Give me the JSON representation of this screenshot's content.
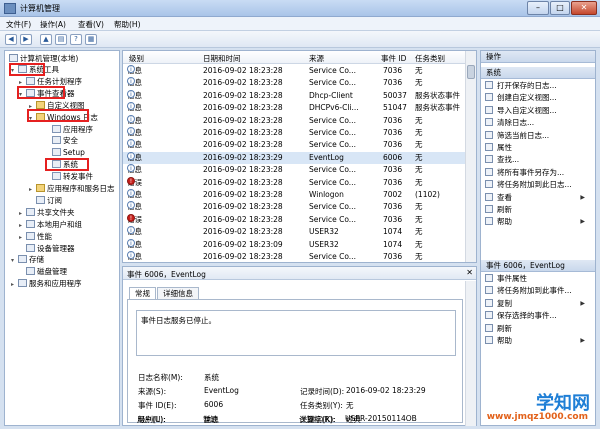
{
  "window": {
    "title": "计算机管理",
    "buttons": [
      "–",
      "□",
      "✕"
    ]
  },
  "menu": [
    "文件(F)",
    "操作(A)",
    "查看(V)",
    "帮助(H)"
  ],
  "tree": {
    "root": "计算机管理(本地)",
    "items": [
      {
        "label": "系统工具",
        "level": 0,
        "arrow": "▾",
        "icon": "computer-tools-icon"
      },
      {
        "label": "任务计划程序",
        "level": 1,
        "arrow": "▸",
        "icon": "clock-icon"
      },
      {
        "label": "事件查看器",
        "level": 1,
        "arrow": "▾",
        "icon": "event-viewer-icon"
      },
      {
        "label": "自定义视图",
        "level": 2,
        "arrow": "▸",
        "icon": "folder-icon"
      },
      {
        "label": "Windows 日志",
        "level": 2,
        "arrow": "▾",
        "icon": "folder-icon"
      },
      {
        "label": "应用程序",
        "level": 3,
        "arrow": "",
        "icon": "log-icon"
      },
      {
        "label": "安全",
        "level": 3,
        "arrow": "",
        "icon": "log-icon"
      },
      {
        "label": "Setup",
        "level": 3,
        "arrow": "",
        "icon": "log-icon"
      },
      {
        "label": "系统",
        "level": 3,
        "arrow": "",
        "icon": "log-icon"
      },
      {
        "label": "转发事件",
        "level": 3,
        "arrow": "",
        "icon": "log-icon"
      },
      {
        "label": "应用程序和服务日志",
        "level": 2,
        "arrow": "▸",
        "icon": "folder-icon"
      },
      {
        "label": "订阅",
        "level": 2,
        "arrow": "",
        "icon": "subscription-icon"
      },
      {
        "label": "共享文件夹",
        "level": 1,
        "arrow": "▸",
        "icon": "shared-folder-icon"
      },
      {
        "label": "本地用户和组",
        "level": 1,
        "arrow": "▸",
        "icon": "users-icon"
      },
      {
        "label": "性能",
        "level": 1,
        "arrow": "▸",
        "icon": "performance-icon"
      },
      {
        "label": "设备管理器",
        "level": 1,
        "arrow": "",
        "icon": "device-manager-icon"
      },
      {
        "label": "存储",
        "level": 0,
        "arrow": "▾",
        "icon": "storage-icon"
      },
      {
        "label": "磁盘管理",
        "level": 1,
        "arrow": "",
        "icon": "disk-icon"
      },
      {
        "label": "服务和应用程序",
        "level": 0,
        "arrow": "▸",
        "icon": "services-icon"
      }
    ]
  },
  "events": {
    "columns": [
      "级别",
      "日期和时间",
      "来源",
      "事件 ID",
      "任务类别"
    ],
    "rows": [
      {
        "level": "信息",
        "type": "info",
        "datetime": "2016-09-02 18:23:28",
        "source": "Service Co...",
        "id": "7036",
        "task": "无"
      },
      {
        "level": "信息",
        "type": "info",
        "datetime": "2016-09-02 18:23:28",
        "source": "Service Co...",
        "id": "7036",
        "task": "无"
      },
      {
        "level": "信息",
        "type": "info",
        "datetime": "2016-09-02 18:23:28",
        "source": "Dhcp-Client",
        "id": "50037",
        "task": "服务状态事件"
      },
      {
        "level": "信息",
        "type": "info",
        "datetime": "2016-09-02 18:23:28",
        "source": "DHCPv6-Cli...",
        "id": "51047",
        "task": "服务状态事件"
      },
      {
        "level": "信息",
        "type": "info",
        "datetime": "2016-09-02 18:23:28",
        "source": "Service Co...",
        "id": "7036",
        "task": "无"
      },
      {
        "level": "信息",
        "type": "info",
        "datetime": "2016-09-02 18:23:28",
        "source": "Service Co...",
        "id": "7036",
        "task": "无"
      },
      {
        "level": "信息",
        "type": "info",
        "datetime": "2016-09-02 18:23:28",
        "source": "Service Co...",
        "id": "7036",
        "task": "无"
      },
      {
        "level": "信息",
        "type": "info",
        "datetime": "2016-09-02 18:23:29",
        "source": "EventLog",
        "id": "6006",
        "task": "无",
        "selected": true
      },
      {
        "level": "信息",
        "type": "info",
        "datetime": "2016-09-02 18:23:28",
        "source": "Service Co...",
        "id": "7036",
        "task": "无"
      },
      {
        "level": "错误",
        "type": "error",
        "datetime": "2016-09-02 18:23:28",
        "source": "Service Co...",
        "id": "7036",
        "task": "无"
      },
      {
        "level": "信息",
        "type": "info",
        "datetime": "2016-09-02 18:23:28",
        "source": "Winlogon",
        "id": "7002",
        "task": "(1102)"
      },
      {
        "level": "信息",
        "type": "info",
        "datetime": "2016-09-02 18:23:28",
        "source": "Service Co...",
        "id": "7036",
        "task": "无"
      },
      {
        "level": "错误",
        "type": "error",
        "datetime": "2016-09-02 18:23:28",
        "source": "Service Co...",
        "id": "7036",
        "task": "无"
      },
      {
        "level": "信息",
        "type": "info",
        "datetime": "2016-09-02 18:23:28",
        "source": "USER32",
        "id": "1074",
        "task": "无"
      },
      {
        "level": "信息",
        "type": "info",
        "datetime": "2016-09-02 18:23:09",
        "source": "USER32",
        "id": "1074",
        "task": "无"
      },
      {
        "level": "信息",
        "type": "info",
        "datetime": "2016-09-02 18:23:28",
        "source": "Service Co...",
        "id": "7036",
        "task": "无"
      }
    ]
  },
  "detail": {
    "title": "事件 6006，EventLog",
    "tabs": [
      "常规",
      "详细信息"
    ],
    "message": "事件日志服务已停止。",
    "fields": {
      "log_name_label": "日志名称(M):",
      "log_name": "系统",
      "source_label": "来源(S):",
      "source": "EventLog",
      "recorded_label": "记录时间(D):",
      "recorded": "2016-09-02 18:23:29",
      "event_id_label": "事件 ID(E):",
      "event_id": "6006",
      "task_label": "任务类别(Y):",
      "task": "无",
      "level_label": "级别(L):",
      "level": "信息",
      "keywords_label": "关键字(K):",
      "keywords": "经典",
      "user_label": "用户(U):",
      "user": "暂缺",
      "computer_label": "计算机(R):",
      "computer": "USER-20150114OB"
    }
  },
  "actions": {
    "header": "操作",
    "section1": "系统",
    "items1": [
      {
        "label": "打开保存的日志...",
        "icon": "open-log-icon"
      },
      {
        "label": "创建自定义视图...",
        "icon": "create-view-icon"
      },
      {
        "label": "导入自定义视图...",
        "icon": "import-view-icon"
      },
      {
        "label": "清除日志...",
        "icon": "clear-log-icon"
      },
      {
        "label": "筛选当前日志...",
        "icon": "filter-icon"
      },
      {
        "label": "属性",
        "icon": "properties-icon"
      },
      {
        "label": "查找...",
        "icon": "find-icon"
      },
      {
        "label": "将所有事件另存为...",
        "icon": "save-icon"
      },
      {
        "label": "将任务附加到此日志...",
        "icon": "attach-task-icon"
      },
      {
        "label": "查看",
        "icon": "view-icon",
        "submenu": true
      },
      {
        "label": "刷新",
        "icon": "refresh-icon"
      },
      {
        "label": "帮助",
        "icon": "help-icon",
        "submenu": true
      }
    ],
    "section2": "事件 6006，EventLog",
    "items2": [
      {
        "label": "事件属性",
        "icon": "event-properties-icon"
      },
      {
        "label": "将任务附加到此事件...",
        "icon": "attach-event-task-icon"
      },
      {
        "label": "复制",
        "icon": "copy-icon",
        "submenu": true
      },
      {
        "label": "保存选择的事件...",
        "icon": "save-selected-icon"
      },
      {
        "label": "刷新",
        "icon": "refresh-icon"
      },
      {
        "label": "帮助",
        "icon": "help-icon",
        "submenu": true
      }
    ]
  },
  "watermark": {
    "brand": "学知网",
    "url": "www.jmqz1000.com"
  }
}
